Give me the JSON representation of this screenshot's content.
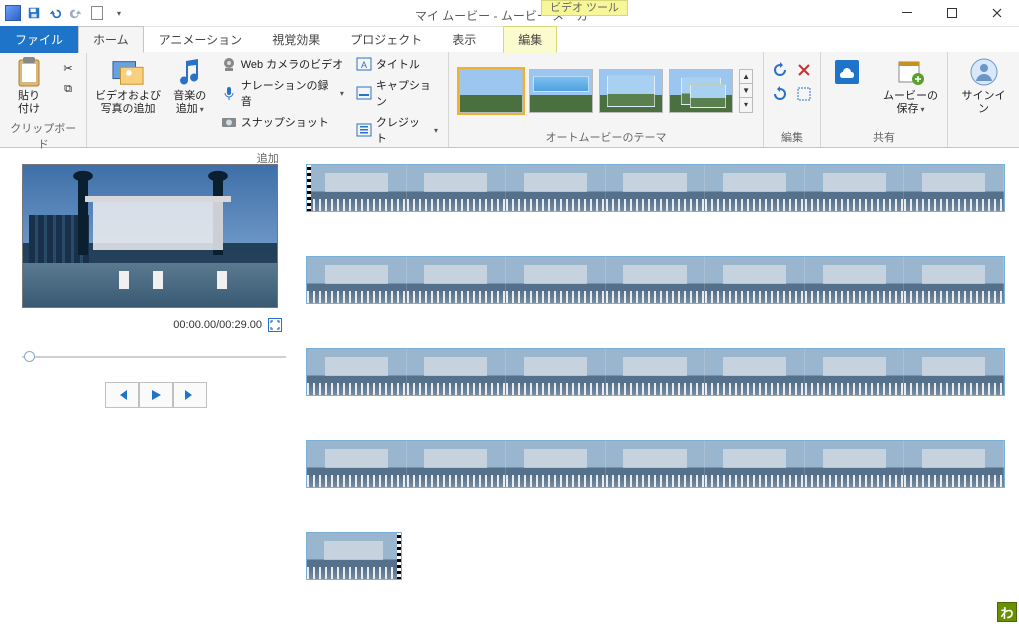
{
  "window": {
    "title": "マイ ムービー - ムービー メーカー",
    "contextual_tool_tag": "ビデオ ツール",
    "contextual_tab": "編集"
  },
  "tabs": {
    "file": "ファイル",
    "list": [
      "ホーム",
      "アニメーション",
      "視覚効果",
      "プロジェクト",
      "表示"
    ],
    "active_index": 0
  },
  "ribbon": {
    "clipboard": {
      "label": "クリップボード",
      "paste": "貼り\n付け"
    },
    "add": {
      "label": "追加",
      "add_media": "ビデオおよび\n写真の追加",
      "add_music": "音楽の\n追加",
      "webcam": "Web カメラのビデオ",
      "narration": "ナレーションの録音",
      "snapshot": "スナップショット",
      "titlebtn": "タイトル",
      "caption": "キャプション",
      "credits": "クレジット"
    },
    "themes": {
      "label": "オートムービーのテーマ"
    },
    "edit": {
      "label": "編集"
    },
    "share": {
      "label": "共有",
      "save_movie": "ムービーの\n保存"
    },
    "signin": {
      "label": "サインイン"
    }
  },
  "preview": {
    "time_current": "00:00.00",
    "time_total": "00:29.00"
  },
  "badge": "わ"
}
